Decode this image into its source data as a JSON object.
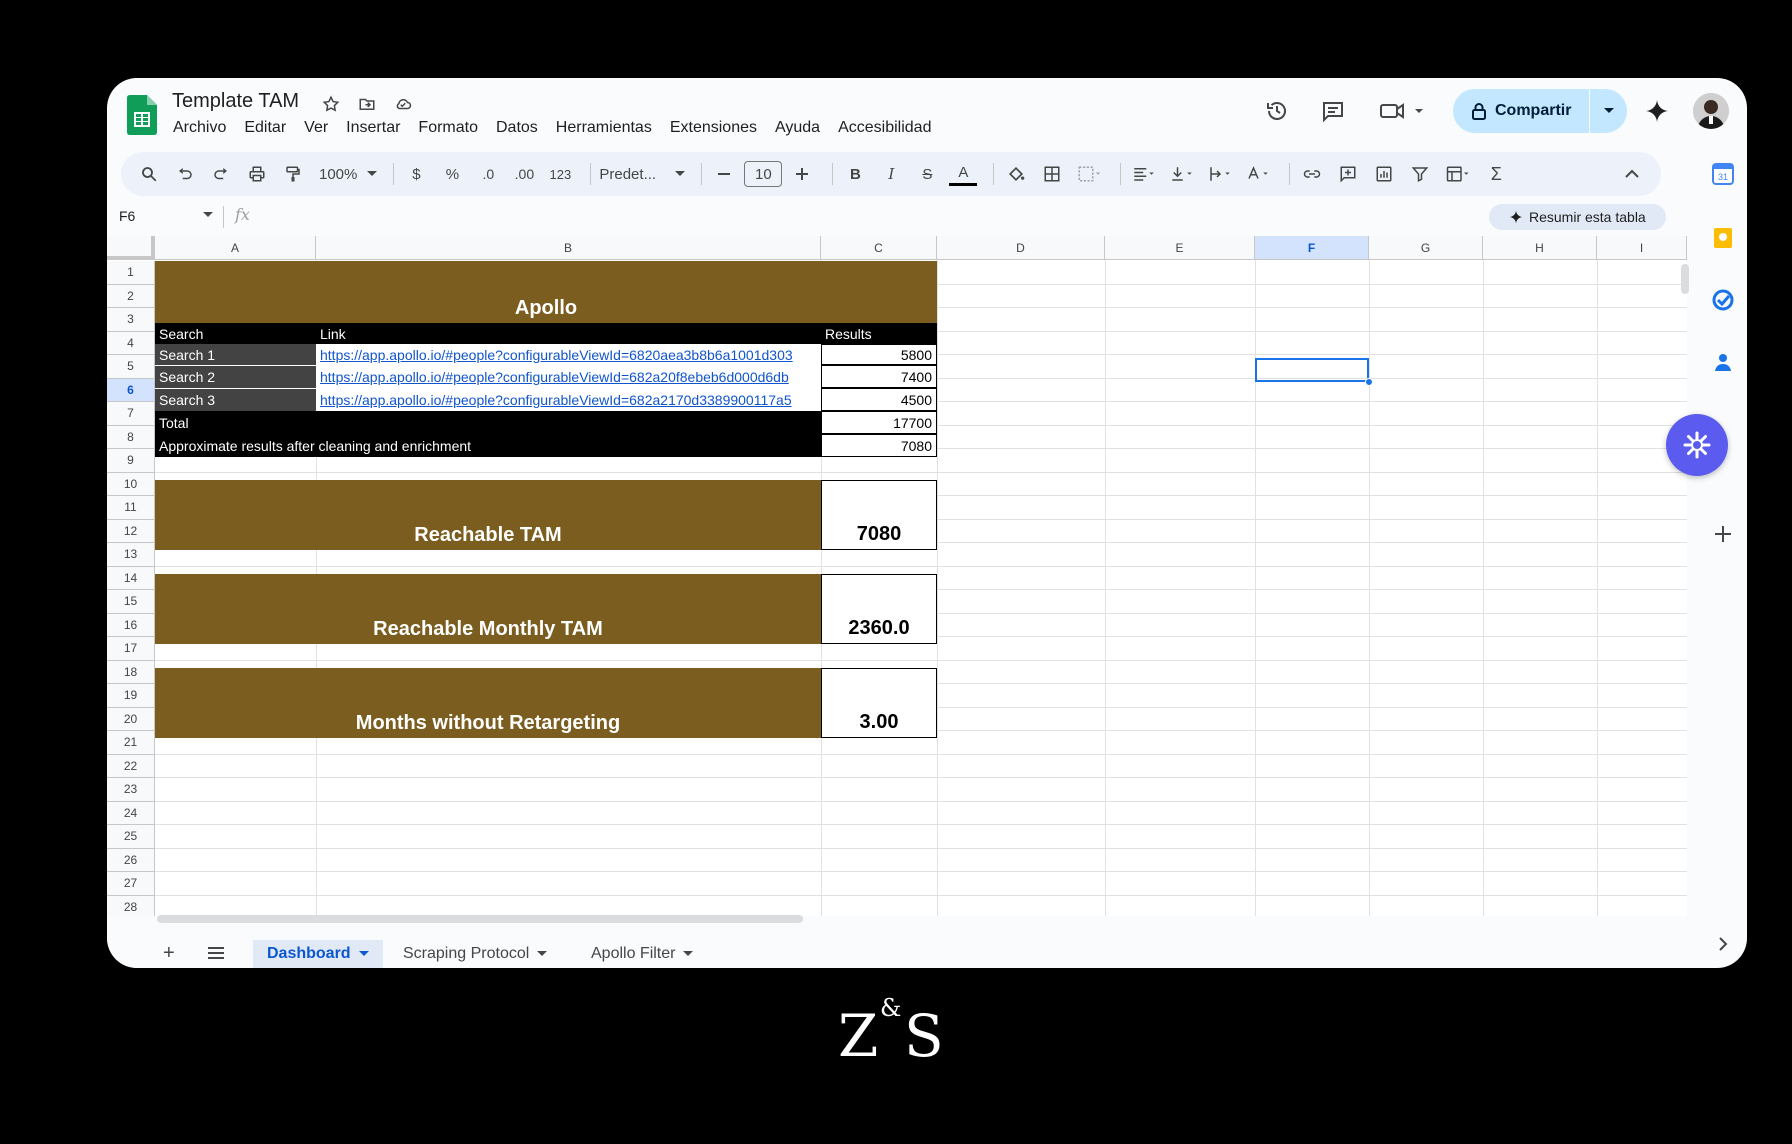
{
  "document": {
    "title": "Template TAM",
    "menu": [
      "Archivo",
      "Editar",
      "Ver",
      "Insertar",
      "Formato",
      "Datos",
      "Herramientas",
      "Extensiones",
      "Ayuda",
      "Accesibilidad"
    ]
  },
  "header": {
    "share_label": "Compartir"
  },
  "toolbar": {
    "zoom": "100%",
    "currency": "$",
    "percent": "%",
    "decrease_decimals": ".0",
    "increase_decimals": ".00",
    "number_format": "123",
    "font": "Predet...",
    "font_size": "10",
    "bold": "B",
    "italic": "I",
    "strike": "S",
    "text_color": "A"
  },
  "formula_bar": {
    "name_box": "F6",
    "fx": "fx",
    "summarize_label": "Resumir esta tabla"
  },
  "grid": {
    "columns": [
      "A",
      "B",
      "C",
      "D",
      "E",
      "F",
      "G",
      "H",
      "I"
    ],
    "selected_column": "F",
    "rows": [
      "1",
      "2",
      "3",
      "4",
      "5",
      "6",
      "7",
      "8",
      "9",
      "10",
      "11",
      "12",
      "13",
      "14",
      "15",
      "16",
      "17",
      "18",
      "19",
      "20",
      "21",
      "22",
      "23",
      "24",
      "25",
      "26",
      "27",
      "28"
    ],
    "selected_row": "6"
  },
  "sheet": {
    "apollo_title": "Apollo",
    "headers": {
      "search": "Search",
      "link": "Link",
      "results": "Results"
    },
    "searches": [
      {
        "name": "Search 1",
        "link": "https://app.apollo.io/#people?configurableViewId=6820aea3b8b6a1001d303",
        "results": "5800"
      },
      {
        "name": "Search 2",
        "link": "https://app.apollo.io/#people?configurableViewId=682a20f8ebeb6d000d6db",
        "results": "7400"
      },
      {
        "name": "Search 3",
        "link": "https://app.apollo.io/#people?configurableViewId=682a2170d3389900117a5",
        "results": "4500"
      }
    ],
    "total_label": "Total",
    "total_value": "17700",
    "approx_label": "Approximate results after cleaning and enrichment",
    "approx_value": "7080",
    "reachable_tam_label": "Reachable TAM",
    "reachable_tam_value": "7080",
    "monthly_tam_label": "Reachable Monthly TAM",
    "monthly_tam_value": "2360.0",
    "months_label": "Months without Retargeting",
    "months_value": "3.00"
  },
  "sheet_tabs": [
    {
      "label": "Dashboard",
      "active": true
    },
    {
      "label": "Scraping Protocol",
      "active": false
    },
    {
      "label": "Apollo Filter",
      "active": false
    }
  ],
  "colors": {
    "gold": "#7a5d1f",
    "share_bg": "#c2e7ff",
    "accent": "#0b57d0",
    "fab": "#5b5bf0"
  },
  "brand": {
    "left": "Z",
    "amp": "&",
    "right": "S"
  }
}
